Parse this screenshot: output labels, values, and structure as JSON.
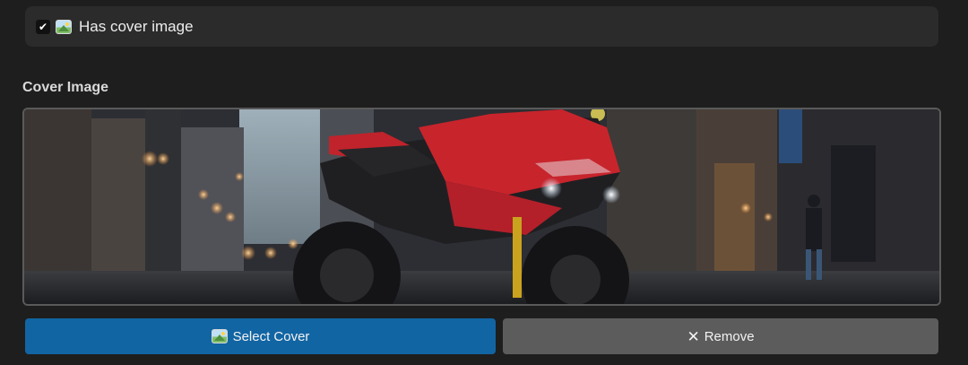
{
  "cover_toggle": {
    "checked": true,
    "label": "Has cover image",
    "icon": "framed-picture-icon"
  },
  "cover_section": {
    "title": "Cover Image",
    "image_icon": "motorcycle-city-street-photo"
  },
  "buttons": {
    "select_label": "Select Cover",
    "select_icon": "framed-picture-icon",
    "remove_label": "Remove",
    "remove_icon": "close-icon",
    "select_color": "#1265a3",
    "remove_color": "#5c5c5c"
  }
}
